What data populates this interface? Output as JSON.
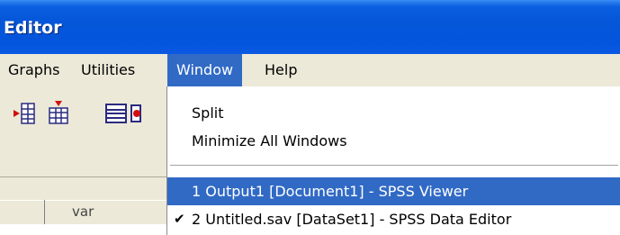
{
  "window": {
    "title": "Editor"
  },
  "menubar": {
    "items": [
      {
        "label": "Graphs"
      },
      {
        "label": "Utilities"
      },
      {
        "label": "Window"
      },
      {
        "label": "Help"
      }
    ]
  },
  "grid": {
    "column_header": "var"
  },
  "window_menu": {
    "items": [
      {
        "label": "Split"
      },
      {
        "label": "Minimize All Windows"
      },
      {
        "label": "1 Output1 [Document1] - SPSS Viewer"
      },
      {
        "label": "2 Untitled.sav [DataSet1] - SPSS Data Editor"
      }
    ],
    "checked_glyph": "✔"
  },
  "icons": [
    "insert-variable-icon",
    "insert-case-icon",
    "split-file-icon",
    "weight-cases-icon",
    "checkmark-icon"
  ],
  "colors": {
    "title_bar": "#0355dd",
    "highlight": "#316ac5",
    "menu_bg": "#ece9d8"
  }
}
